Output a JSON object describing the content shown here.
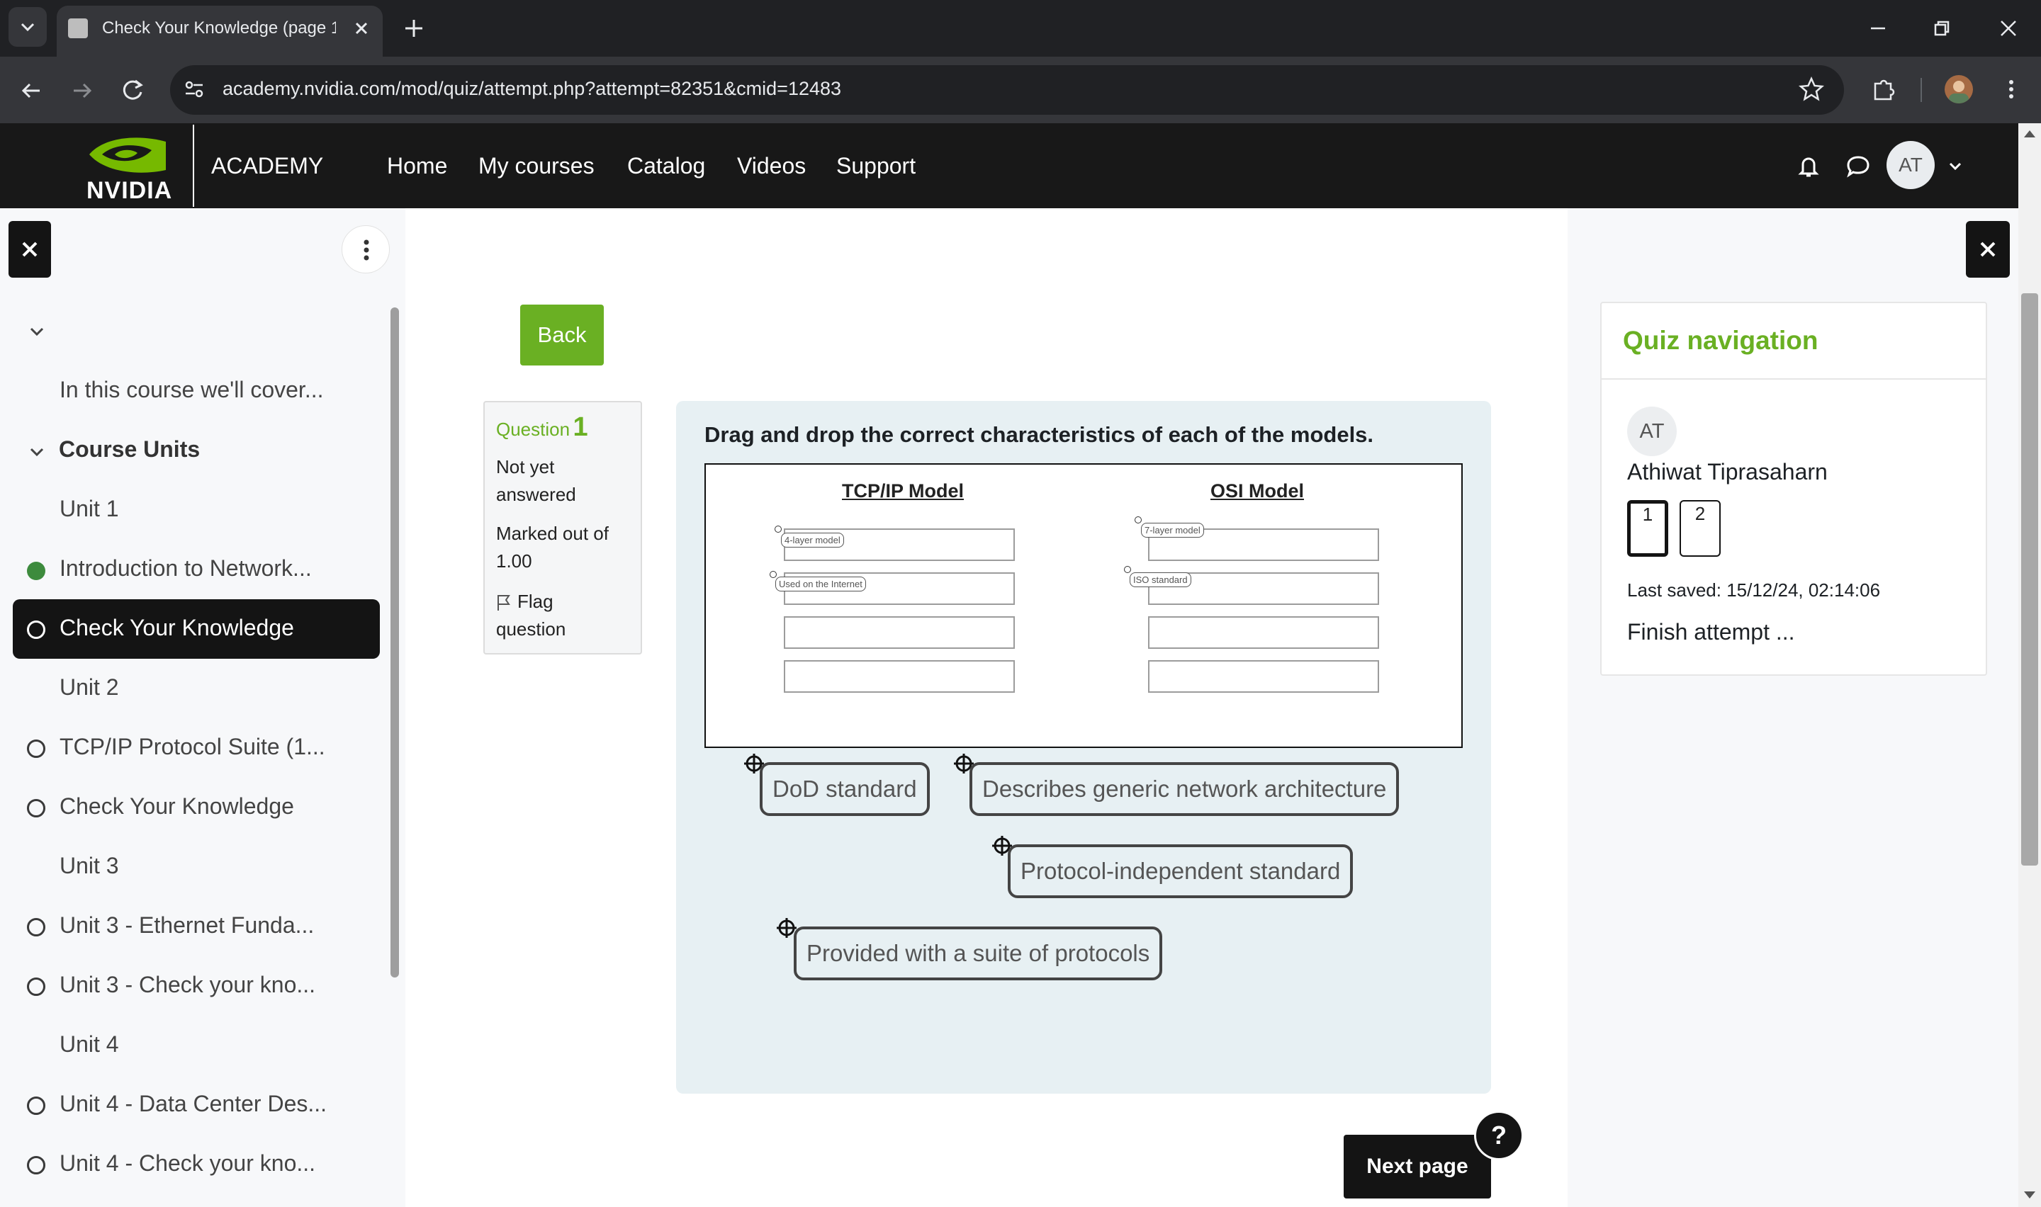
{
  "browser": {
    "tab_title": "Check Your Knowledge (page 1",
    "url": "academy.nvidia.com/mod/quiz/attempt.php?attempt=82351&cmid=12483",
    "accent": "#202124"
  },
  "site": {
    "logo_text": "NVIDIA",
    "academy_label": "ACADEMY",
    "nav": [
      "Home",
      "My courses",
      "Catalog",
      "Videos",
      "Support"
    ],
    "user_initials": "AT",
    "brand_green": "#76b900"
  },
  "drawer": {
    "intro": "In this course we'll cover...",
    "section": "Course Units",
    "items": [
      {
        "label": "Unit 1",
        "status": "none"
      },
      {
        "label": "Introduction to Network...",
        "status": "complete"
      },
      {
        "label": "Check Your Knowledge",
        "status": "current"
      },
      {
        "label": "Unit 2",
        "status": "none"
      },
      {
        "label": "TCP/IP Protocol Suite (1...",
        "status": "todo"
      },
      {
        "label": "Check Your Knowledge",
        "status": "todo"
      },
      {
        "label": "Unit 3",
        "status": "none"
      },
      {
        "label": "Unit 3 - Ethernet Funda...",
        "status": "todo"
      },
      {
        "label": "Unit 3 - Check your kno...",
        "status": "todo"
      },
      {
        "label": "Unit 4",
        "status": "none"
      },
      {
        "label": "Unit 4 - Data Center Des...",
        "status": "todo"
      },
      {
        "label": "Unit 4 - Check your kno...",
        "status": "todo"
      }
    ]
  },
  "quiz": {
    "back_label": "Back",
    "question_label": "Question",
    "question_number": "1",
    "status": "Not yet answered",
    "marked": "Marked out of 1.00",
    "flag": "Flag question",
    "prompt": "Drag and drop the correct characteristics of each of the models.",
    "col_tcp": "TCP/IP Model",
    "col_osi": "OSI Model",
    "placed": {
      "tcp_1": "4-layer model",
      "tcp_2": "Used on the Internet",
      "osi_1": "7-layer model",
      "osi_2": "ISO standard"
    },
    "draggables": [
      "DoD standard",
      "Describes generic network architecture",
      "Protocol-independent standard",
      "Provided with a suite of protocols"
    ],
    "next_label": "Next page",
    "help_label": "?"
  },
  "quiz_nav": {
    "title": "Quiz navigation",
    "initials": "AT",
    "user": "Athiwat Tiprasaharn",
    "pages": [
      "1",
      "2"
    ],
    "last_saved": "Last saved: 15/12/24, 02:14:06",
    "finish": "Finish attempt ..."
  }
}
